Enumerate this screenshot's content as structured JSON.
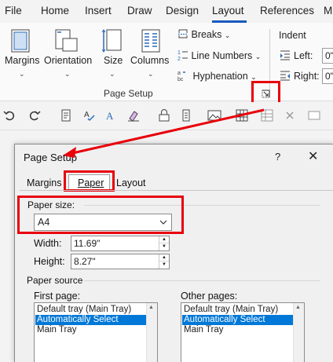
{
  "menubar": {
    "items": [
      "File",
      "Home",
      "Insert",
      "Draw",
      "Design",
      "Layout",
      "References",
      "M"
    ],
    "active": "Layout"
  },
  "ribbon": {
    "margins": "Margins",
    "orientation": "Orientation",
    "size": "Size",
    "columns": "Columns",
    "breaks": "Breaks",
    "line_numbers": "Line Numbers",
    "hyphenation": "Hyphenation",
    "group_label": "Page Setup",
    "indent_label": "Indent",
    "left_label": "Left:",
    "right_label": "Right:",
    "left_value": "0\"",
    "right_value": "0\""
  },
  "toolbar": {
    "icons": [
      "undo-icon",
      "redo-icon",
      "copy-format-icon",
      "spelling-icon",
      "text-effects-icon",
      "highlight-icon",
      "lock-icon",
      "move-icon",
      "image-icon",
      "table-icon",
      "delete-table-icon",
      "table-props-icon",
      "more-icon"
    ]
  },
  "dialog": {
    "title": "Page Setup",
    "help": "?",
    "close": "✕",
    "tabs": [
      "Margins",
      "Paper",
      "Layout"
    ],
    "active_tab": "Paper",
    "paper_size_label": "Paper size:",
    "paper_size_value": "A4",
    "width_label": "Width:",
    "width_value": "11.69\"",
    "height_label": "Height:",
    "height_value": "8.27\"",
    "paper_source_label": "Paper source",
    "first_page_label": "First page:",
    "other_pages_label": "Other pages:",
    "first_page_options": [
      "Default tray (Main Tray)",
      "Automatically Select",
      "Main Tray"
    ],
    "other_pages_options": [
      "Default tray (Main Tray)",
      "Automatically Select",
      "Main Tray"
    ],
    "selected_option": "Automatically Select"
  },
  "colors": {
    "highlight": "#e8000b",
    "accent": "#185abd",
    "selection": "#0078d7",
    "ribbon_icon_blue": "#2b6cb8"
  }
}
